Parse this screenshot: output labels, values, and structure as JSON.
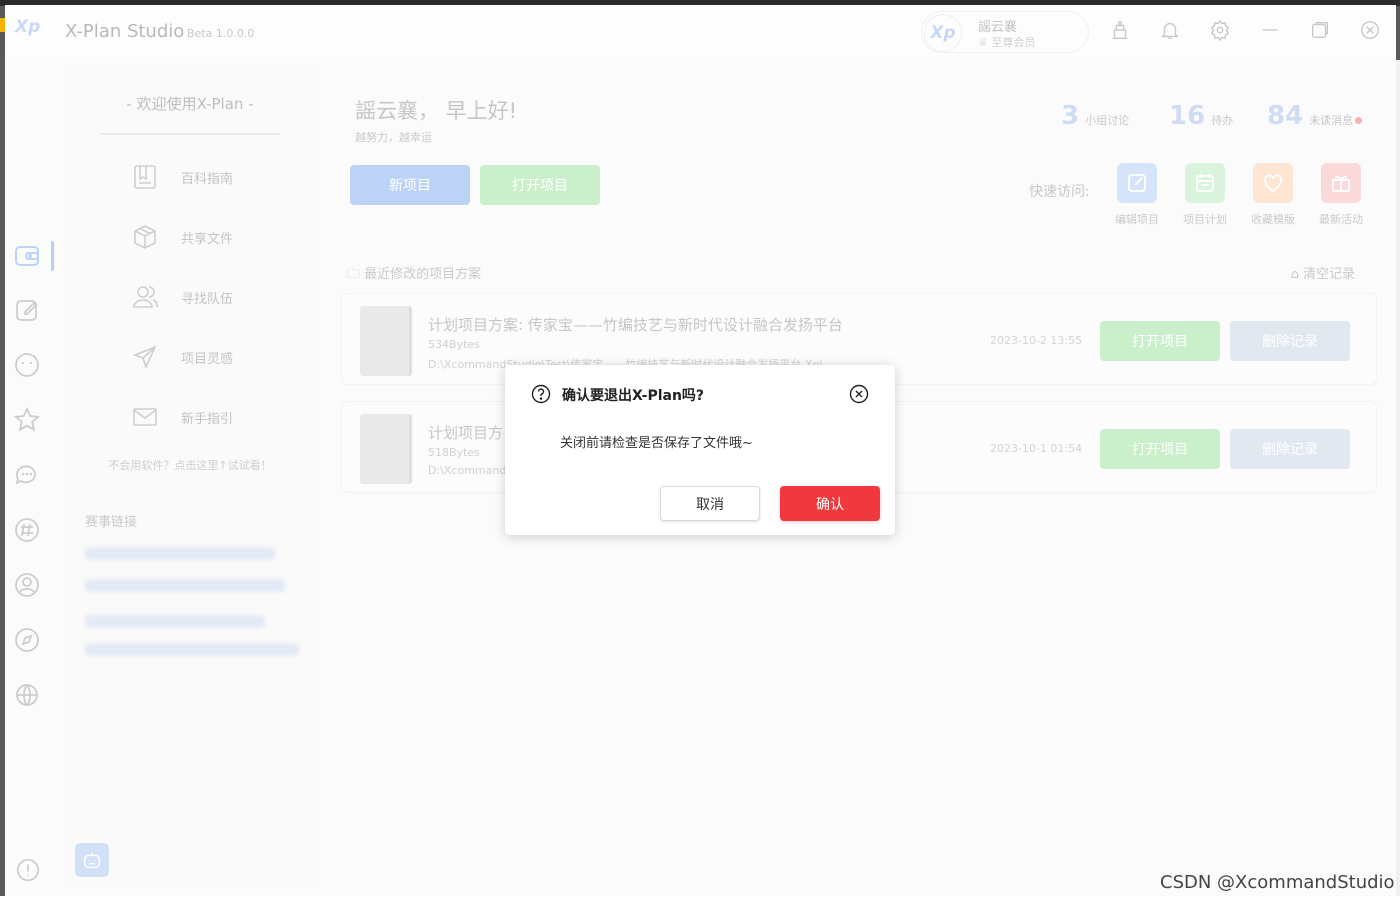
{
  "app": {
    "logo_text": "Xp",
    "title": "X-Plan Studio",
    "version": "Beta 1.0.0.0"
  },
  "user": {
    "avatar_text": "Xp",
    "name": "謡云襄",
    "role": "至尊会员"
  },
  "side": {
    "welcome": "- 欢迎使用X-Plan -",
    "items": [
      {
        "label": "百科指南",
        "icon": "book-icon"
      },
      {
        "label": "共享文件",
        "icon": "box-icon"
      },
      {
        "label": "寻找队伍",
        "icon": "team-icon"
      },
      {
        "label": "项目灵感",
        "icon": "send-icon"
      },
      {
        "label": "新手指引",
        "icon": "mail-icon"
      }
    ],
    "hint": "不会用软件？点击这里↑试试看！",
    "section_title": "赛事链接"
  },
  "header": {
    "greeting": "謡云襄， 早上好!",
    "motto": "越努力，越幸运",
    "new_project": "新项目",
    "open_project": "打开项目",
    "stats": [
      {
        "num": "3",
        "label": "小组讨论"
      },
      {
        "num": "16",
        "label": "待办"
      },
      {
        "num": "84",
        "label": "未读消息"
      }
    ],
    "quick_label": "快速访问:",
    "quick": [
      {
        "label": "编辑项目",
        "icon": "edit-icon",
        "color": "#d6e4fa"
      },
      {
        "label": "项目计划",
        "icon": "calendar-icon",
        "color": "#d9f3dd"
      },
      {
        "label": "收藏模版",
        "icon": "heart-icon",
        "color": "#fde6d3"
      },
      {
        "label": "最新活动",
        "icon": "gift-icon",
        "color": "#fbd9d9"
      }
    ]
  },
  "recent": {
    "title": "最近修改的项目方案",
    "clear": "清空记录",
    "projects": [
      {
        "title": "计划项目方案: 传家宝——竹编技艺与新时代设计融合发扬平台",
        "size": "534Bytes",
        "path": "D:\\XcommandStudio\\Test\\传家宝——竹编技艺与新时代设计融合发扬平台.Xpl",
        "date": "2023-10-2 13:55",
        "open": "打开项目",
        "delete": "删除记录"
      },
      {
        "title": "计划项目方",
        "size": "518Bytes",
        "path": "D:\\Xcommand",
        "date": "2023-10-1 01:54",
        "open": "打开项目",
        "delete": "删除记录"
      }
    ]
  },
  "dialog": {
    "title": "确认要退出X-Plan吗?",
    "message": "关闭前请检查是否保存了文件哦~",
    "cancel": "取消",
    "confirm": "确认"
  },
  "watermark": "CSDN @XcommandStudio",
  "colors": {
    "accent_blue": "#bcd3f6",
    "accent_green": "#c9eec9",
    "danger": "#f0393f"
  }
}
